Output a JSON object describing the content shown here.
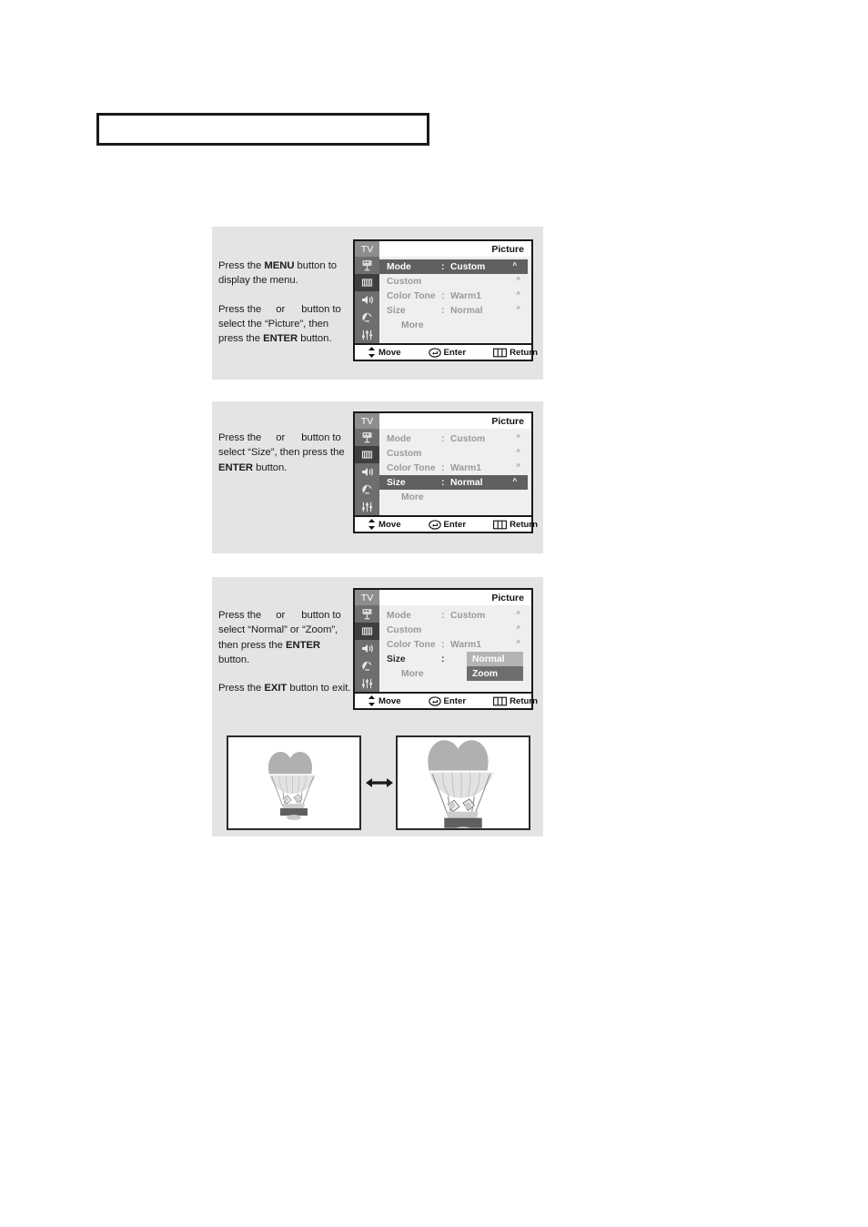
{
  "document": {
    "title_box_text": ""
  },
  "osd_common": {
    "tv_label": "TV",
    "menu_title": "Picture",
    "rows": {
      "mode_label": "Mode",
      "mode_colon": ":",
      "mode_value": "Custom",
      "custom_label": "Custom",
      "color_tone_label": "Color Tone",
      "color_tone_colon": ":",
      "color_tone_value": "Warm1",
      "size_label": "Size",
      "size_colon": ":",
      "size_value": "Normal",
      "more_label": "More",
      "caret": "^"
    },
    "options": {
      "normal": "Normal",
      "zoom": "Zoom"
    },
    "footer": {
      "move": "Move",
      "enter": "Enter",
      "return": "Return"
    },
    "icons": [
      "input-plug-icon",
      "picture-icon",
      "sound-speaker-icon",
      "channel-dish-icon",
      "setup-sliders-icon"
    ]
  },
  "steps": [
    {
      "id": "step-1",
      "line1_a": "Press the ",
      "line1_b": "MENU",
      "line1_c": " button to display the menu.",
      "line2_a": "Press the",
      "line2_b": "or",
      "line2_c": "button to select the “Picture”, then press the ",
      "line2_d": "ENTER",
      "line2_e": " button."
    },
    {
      "id": "step-2",
      "line1_a": "Press the",
      "line1_b": "or",
      "line1_c": "button to select “Size”, then press the ",
      "line1_d": "ENTER",
      "line1_e": " button."
    },
    {
      "id": "step-3",
      "line1_a": "Press the",
      "line1_b": "or",
      "line1_c": "button to select “Normal” or “Zoom”, then press the ",
      "line1_d": "ENTER",
      "line1_e": " button.",
      "line2_a": "Press the ",
      "line2_b": "EXIT",
      "line2_c": " button to exit."
    }
  ],
  "illustration": {
    "left_name": "normal-picture-size-example",
    "right_name": "zoom-picture-size-example",
    "arrow_name": "double-headed-swap-arrow"
  },
  "colors": {
    "panel_bg": "#e4e4e4",
    "osd_bg": "#efefef",
    "rail_bg": "#6e6e6e",
    "rail_active": "#3f3f3f",
    "highlight": "#606060",
    "dropdown_normal": "#b4b4b4",
    "dropdown_zoom": "#6e6e6e",
    "text_dim": "#9a9a9a",
    "text_dark": "#1c1c1c"
  }
}
